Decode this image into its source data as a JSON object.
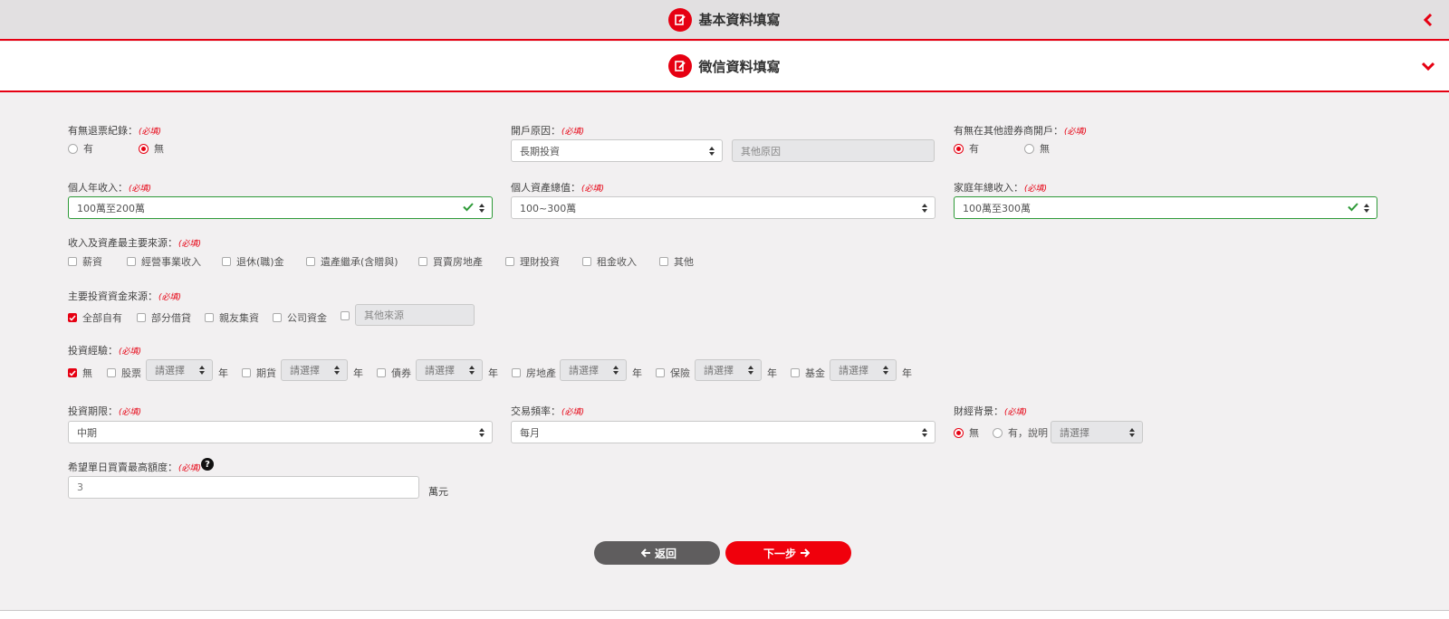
{
  "sections": [
    {
      "title": "基本資料填寫",
      "icon": "edit-form-icon",
      "state": "collapsed"
    },
    {
      "title": "徵信資料填寫",
      "icon": "edit-form-icon",
      "state": "expanded"
    }
  ],
  "required_tag": "(必填)",
  "bounced_check": {
    "label": "有無退票紀錄：",
    "options": [
      "有",
      "無"
    ],
    "selected": "無"
  },
  "open_reason": {
    "label": "開戶原因：",
    "value": "長期投資",
    "other_placeholder": "其他原因"
  },
  "other_broker": {
    "label": "有無在其他證券商開戶：",
    "options": [
      "有",
      "無"
    ],
    "selected": "有"
  },
  "annual_income": {
    "label": "個人年收入：",
    "value": "100萬至200萬",
    "valid": true
  },
  "total_assets": {
    "label": "個人資產總值：",
    "value": "100~300萬"
  },
  "household_income": {
    "label": "家庭年總收入：",
    "value": "100萬至300萬",
    "valid": true
  },
  "income_sources": {
    "label": "收入及資產最主要來源：",
    "options": [
      "薪資",
      "經營事業收入",
      "退休(職)金",
      "遺產繼承(含贈與)",
      "買賣房地產",
      "理財投資",
      "租金收入",
      "其他"
    ],
    "checked": []
  },
  "fund_sources": {
    "label": "主要投資資金來源：",
    "options": [
      "全部自有",
      "部分借貸",
      "親友集資",
      "公司資金"
    ],
    "checked": [
      "全部自有"
    ],
    "other_placeholder": "其他來源"
  },
  "experience": {
    "label": "投資經驗：",
    "none_label": "無",
    "none_checked": true,
    "unit": "年",
    "select_placeholder": "請選擇",
    "items": [
      "股票",
      "期貨",
      "債券",
      "房地產",
      "保險",
      "基金"
    ]
  },
  "invest_period": {
    "label": "投資期限：",
    "value": "中期"
  },
  "trade_frequency": {
    "label": "交易頻率：",
    "value": "每月"
  },
  "financial_background": {
    "label": "財經背景：",
    "options": [
      "無",
      "有，說明"
    ],
    "selected": "無",
    "select_placeholder": "請選擇"
  },
  "daily_limit": {
    "label": "希望單日買賣最高額度：",
    "value": "3",
    "unit": "萬元",
    "help": "?"
  },
  "buttons": {
    "back": "返回",
    "next": "下一步"
  },
  "colors": {
    "accent": "#e60012",
    "valid": "#2e9a38",
    "back_button": "#5f5d5e"
  }
}
